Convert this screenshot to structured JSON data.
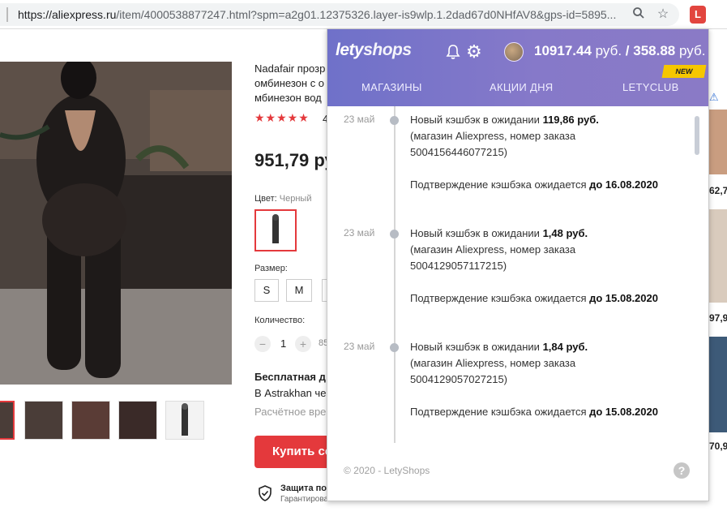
{
  "browser": {
    "url_main": "https://aliexpress.ru",
    "url_rest": "/item/4000538877247.html?spm=a2g01.12375326.layer-is9wlp.1.2dad67d0NHfAV8&gps-id=5895...",
    "zoom_icon": "magnifier-icon",
    "star_icon": "bookmark-star-icon",
    "ext_letter": "L"
  },
  "product": {
    "title_line1": "Nadafair прозр",
    "title_line2": "омбинезон с о",
    "title_line3": "мбинезон вод",
    "rating_stars": "★★★★★",
    "rating_count": "4",
    "price": "951,79 ру",
    "color_label": "Цвет:",
    "color_value": "Черный",
    "size_label": "Размер:",
    "sizes": [
      "S",
      "M",
      ""
    ],
    "qty_label": "Количество:",
    "qty_minus": "−",
    "qty_value": "1",
    "qty_plus": "+",
    "qty_available": "85",
    "shipping_title": "Бесплатная д",
    "shipping_to": "В Astrakhan че",
    "shipping_est": "Расчётное врем",
    "buy_label": "Купить се",
    "protection_title": "Защита по",
    "protection_sub": "Гарантирован"
  },
  "right_prices": [
    "62,7",
    "97,9",
    "70,9"
  ],
  "popup": {
    "logo_a": "lety",
    "logo_b": "shops",
    "balance_main": "10917.44",
    "balance_cur1": "руб.",
    "balance_sep": "/",
    "balance_second": "358.88",
    "balance_cur2": "руб.",
    "tabs": [
      "МАГАЗИНЫ",
      "АКЦИИ ДНЯ",
      "LETYCLUB"
    ],
    "new_badge": "NEW",
    "entries": [
      {
        "date": "23 май",
        "line1_prefix": "Новый кэшбэк в ожидании ",
        "line1_amount": "119,86 руб.",
        "line2": "(магазин Aliexpress, номер заказа",
        "line3": "5004156446077215)",
        "confirm_prefix": "Подтверждение кэшбэка ожидается ",
        "confirm_date": "до 16.08.2020"
      },
      {
        "date": "23 май",
        "line1_prefix": "Новый кэшбэк в ожидании ",
        "line1_amount": "1,48 руб.",
        "line2": "(магазин Aliexpress, номер заказа",
        "line3": "5004129057117215)",
        "confirm_prefix": "Подтверждение кэшбэка ожидается ",
        "confirm_date": "до 15.08.2020"
      },
      {
        "date": "23 май",
        "line1_prefix": "Новый кэшбэк в ожидании ",
        "line1_amount": "1,84 руб.",
        "line2": "(магазин Aliexpress, номер заказа",
        "line3": "5004129057027215)",
        "confirm_prefix": "Подтверждение кэшбэка ожидается ",
        "confirm_date": "до 15.08.2020"
      }
    ],
    "footer": "© 2020 - LetyShops",
    "help": "?"
  },
  "colors": {
    "accent": "#e4393c",
    "lety_purple": "#7a75c9",
    "badge_yellow": "#f6c700"
  }
}
